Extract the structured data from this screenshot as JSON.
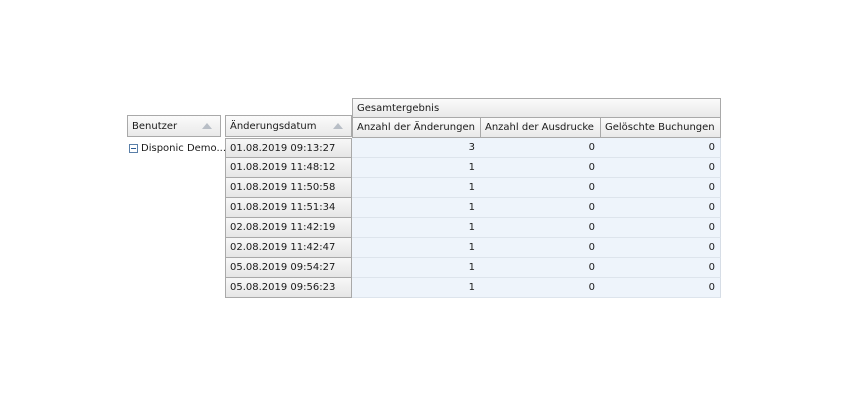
{
  "fields": {
    "user": "Benutzer",
    "date": "Änderungsdatum"
  },
  "column_group": "Gesamtergebnis",
  "columns": [
    "Anzahl der Änderungen",
    "Anzahl der Ausdrucke",
    "Gelöschte Buchungen"
  ],
  "user_row": {
    "label": "Disponic Demo..."
  },
  "rows": [
    {
      "date": "01.08.2019 09:13:27",
      "values": [
        "3",
        "0",
        "0"
      ]
    },
    {
      "date": "01.08.2019 11:48:12",
      "values": [
        "1",
        "0",
        "0"
      ]
    },
    {
      "date": "01.08.2019 11:50:58",
      "values": [
        "1",
        "0",
        "0"
      ]
    },
    {
      "date": "01.08.2019 11:51:34",
      "values": [
        "1",
        "0",
        "0"
      ]
    },
    {
      "date": "02.08.2019 11:42:19",
      "values": [
        "1",
        "0",
        "0"
      ]
    },
    {
      "date": "02.08.2019 11:42:47",
      "values": [
        "1",
        "0",
        "0"
      ]
    },
    {
      "date": "05.08.2019 09:54:27",
      "values": [
        "1",
        "0",
        "0"
      ]
    },
    {
      "date": "05.08.2019 09:56:23",
      "values": [
        "1",
        "0",
        "0"
      ]
    }
  ]
}
